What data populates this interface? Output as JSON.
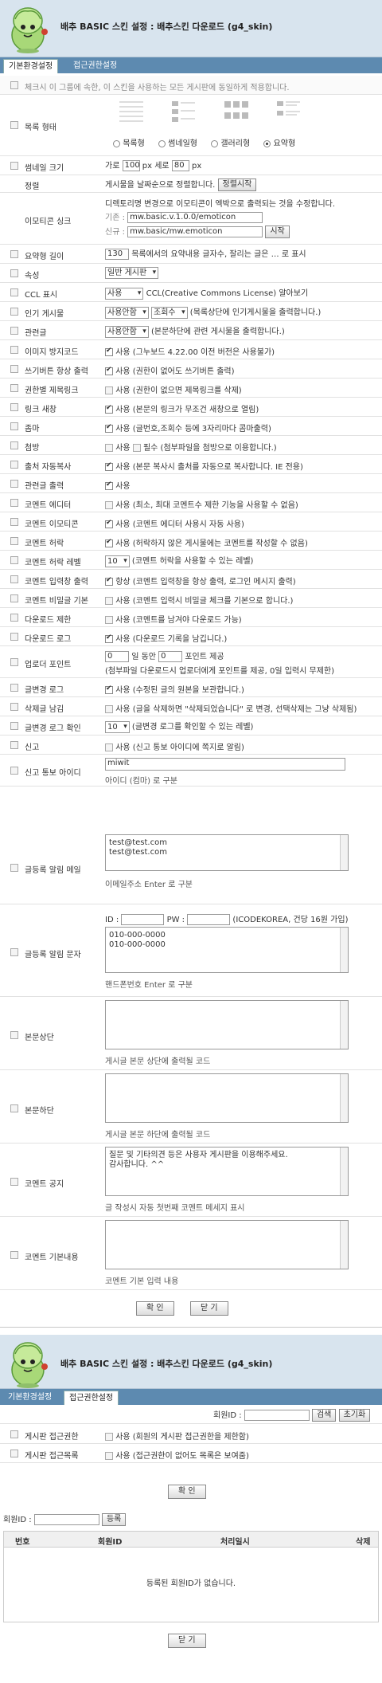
{
  "section1": {
    "title": "배추 BASIC 스킨 설정 : 배추스킨 다운로드 (g4_skin)",
    "tabs": [
      "기본환경설정",
      "접근권한설정"
    ],
    "apply_all_label": "체크시 이 그룹에 속한, 이 스킨을 사용하는 모든 게시판에 동일하게 적용합니다.",
    "list_type": {
      "label": "목록 형태",
      "options": [
        "목록형",
        "썸네일형",
        "갤러리형",
        "요약형"
      ],
      "selected": "요약형"
    },
    "thumb_size": {
      "label": "썸네일 크기",
      "width_label": "가로",
      "width": "100",
      "px1": "px 세로",
      "height": "80",
      "px2": "px"
    },
    "sort": {
      "label": "정렬",
      "text": "게시물을 날짜순으로 정렬합니다.",
      "button": "정렬시작"
    },
    "emoticon": {
      "label": "이모티콘 싱크",
      "desc": "디렉토리명 변경으로 이모티콘이 엑박으로 출력되는 것을 수정합니다.",
      "old_label": "기존 :",
      "old_value": "mw.basic.v.1.0.0/emoticon",
      "new_label": "신규 :",
      "new_value": "mw.basic/mw.emoticon",
      "button": "시작"
    },
    "summary_length": {
      "label": "요약형 길이",
      "value": "130",
      "text": "목록에서의 요약내용 글자수, 잘리는 글은 … 로 표시"
    },
    "attribute": {
      "label": "속성",
      "value": "일반 게시판"
    },
    "ccl": {
      "label": "CCL 표시",
      "value": "사용",
      "text": "CCL(Creative Commons License) 알아보기"
    },
    "popular": {
      "label": "인기 게시물",
      "value1": "사용안함",
      "value2": "조회수",
      "text": "(목록상단에 인기게시물을 출력합니다.)"
    },
    "related": {
      "label": "관련글",
      "value": "사용안함",
      "text": "(본문하단에 관련 게시물을 출력합니다.)"
    },
    "options": [
      {
        "label": "이미지 방지코드",
        "checked": true,
        "text": "사용 (그누보드 4.22.00 이전 버전은 사용불가)"
      },
      {
        "label": "쓰기버튼 항상 출력",
        "checked": true,
        "text": "사용 (권한이 없어도 쓰기버튼 출력)"
      },
      {
        "label": "권한별 제목링크",
        "checked": false,
        "text": "사용 (권한이 없으면 제목링크를 삭제)"
      },
      {
        "label": "링크 새창",
        "checked": true,
        "text": "사용 (본문의 링크가 무조건 새창으로 열림)"
      },
      {
        "label": "좀마",
        "checked": true,
        "text": "사용 (글번호,조회수 등에 3자리마다 콤마출력)"
      }
    ],
    "attach": {
      "label": "첨방",
      "text1": "사용",
      "text2": "필수 (첨부파일을 첨방으로 이용합니다.)"
    },
    "options2": [
      {
        "label": "출처 자동복사",
        "checked": true,
        "text": "사용 (본문 복사시 출처를 자동으로 복사합니다. IE 전용)"
      },
      {
        "label": "관련글 출력",
        "checked": true,
        "text": "사용"
      },
      {
        "label": "코멘트 에디터",
        "checked": false,
        "text": "사용 (최소, 최대 코멘트수 제한 기능을 사용할 수 없음)"
      },
      {
        "label": "코멘트 이모티콘",
        "checked": true,
        "text": "사용 (코멘트 에디터 사용시 자동 사용)"
      },
      {
        "label": "코멘트 허락",
        "checked": true,
        "text": "사용 (허락하지 않은 게시물에는 코멘트를 작성할 수 없음)"
      }
    ],
    "comment_level": {
      "label": "코멘트 허락 레벨",
      "value": "10",
      "text": "(코멘트 허락을 사용할 수 있는 레벨)"
    },
    "options3": [
      {
        "label": "코멘트 입력창 출력",
        "checked": true,
        "text": "항상 (코멘트 입력창을 항상 출력, 로그인 메시지 출력)"
      },
      {
        "label": "코멘트 비밀글 기본",
        "checked": false,
        "text": "사용 (코멘트 입력시 비밀글 체크를 기본으로 합니다.)"
      },
      {
        "label": "다운로드 제한",
        "checked": false,
        "text": "사용 (코멘트를 남겨야 다운로드 가능)"
      },
      {
        "label": "다운로드 로그",
        "checked": true,
        "text": "사용 (다운로드 기록을 남깁니다.)"
      }
    ],
    "upload_point": {
      "label": "업로더 포인트",
      "days": "0",
      "text1": "일 동안",
      "point": "0",
      "text2": "포인트 제공",
      "text3": "(첨부파일 다운로드시 업로더에게 포인트를 제공, 0일 입력시 무제한)"
    },
    "options4": [
      {
        "label": "글변경 로그",
        "checked": true,
        "text": "사용 (수정된 글의 원본을 보관합니다.)"
      },
      {
        "label": "삭제글 남김",
        "checked": false,
        "text": "사용 (글을 삭제하면 \"삭제되었습니다\" 로 변경, 선택삭제는 그냥 삭제됨)"
      }
    ],
    "change_log_level": {
      "label": "글변경 로그 확인",
      "value": "10",
      "text": "(글변경 로그를 확인할 수 있는 레벨)"
    },
    "report": {
      "label": "신고",
      "text": "사용 (신고 통보 아이디에 쪽지로 알림)"
    },
    "report_id": {
      "label": "신고 통보 아이디",
      "value": "miwit",
      "help": "아이디 (컴마) 로 구분"
    },
    "mail": {
      "label": "글등록 알림 메일",
      "value": "test@test.com\ntest@test.com",
      "help": "이메일주소 Enter 로 구분"
    },
    "sms": {
      "label": "글등록 알림 문자",
      "id_label": "ID :",
      "pw_label": "PW :",
      "provider": "(ICODEKOREA, 건당 16원 가입)",
      "value": "010-000-0000\n010-000-0000",
      "help": "핸드폰번호 Enter 로 구분"
    },
    "top": {
      "label": "본문상단",
      "help": "게시글 본문 상단에 출력될 코드"
    },
    "bottom": {
      "label": "본문하단",
      "help": "게시글 본문 하단에 출력될 코드"
    },
    "notice": {
      "label": "코멘트 공지",
      "value": "질문 및 기타의견 등은 사용자 게시판을 이용해주세요.\n감사합니다. ^^",
      "help": "글 작성시 자동 첫번째 코멘트 메세지 표시"
    },
    "default": {
      "label": "코멘트 기본내용",
      "help": "코멘트 기본 입력 내용"
    },
    "ok": "확 인",
    "close": "닫 기"
  },
  "section2": {
    "title": "배추 BASIC 스킨 설정 : 배추스킨 다운로드 (g4_skin)",
    "tabs": [
      "기본환경설정",
      "접근권한설정"
    ],
    "member_id_label": "회원ID :",
    "search_btn": "검색",
    "reset_btn": "초기화",
    "perm_label": "게시판 접근권한",
    "perm_text": "사용 (회원의 게시판 접근권한을 제한함)",
    "list_label": "게시판 접근목록",
    "list_text": "사용 (접근권한이 없어도 목록은 보여줌)",
    "ok": "확 인",
    "reg_label": "회원ID :",
    "reg_btn": "등록",
    "columns": [
      "번호",
      "회원ID",
      "처리일시",
      "삭제"
    ],
    "empty": "등록된 회원ID가 없습니다.",
    "close": "닫 기"
  }
}
